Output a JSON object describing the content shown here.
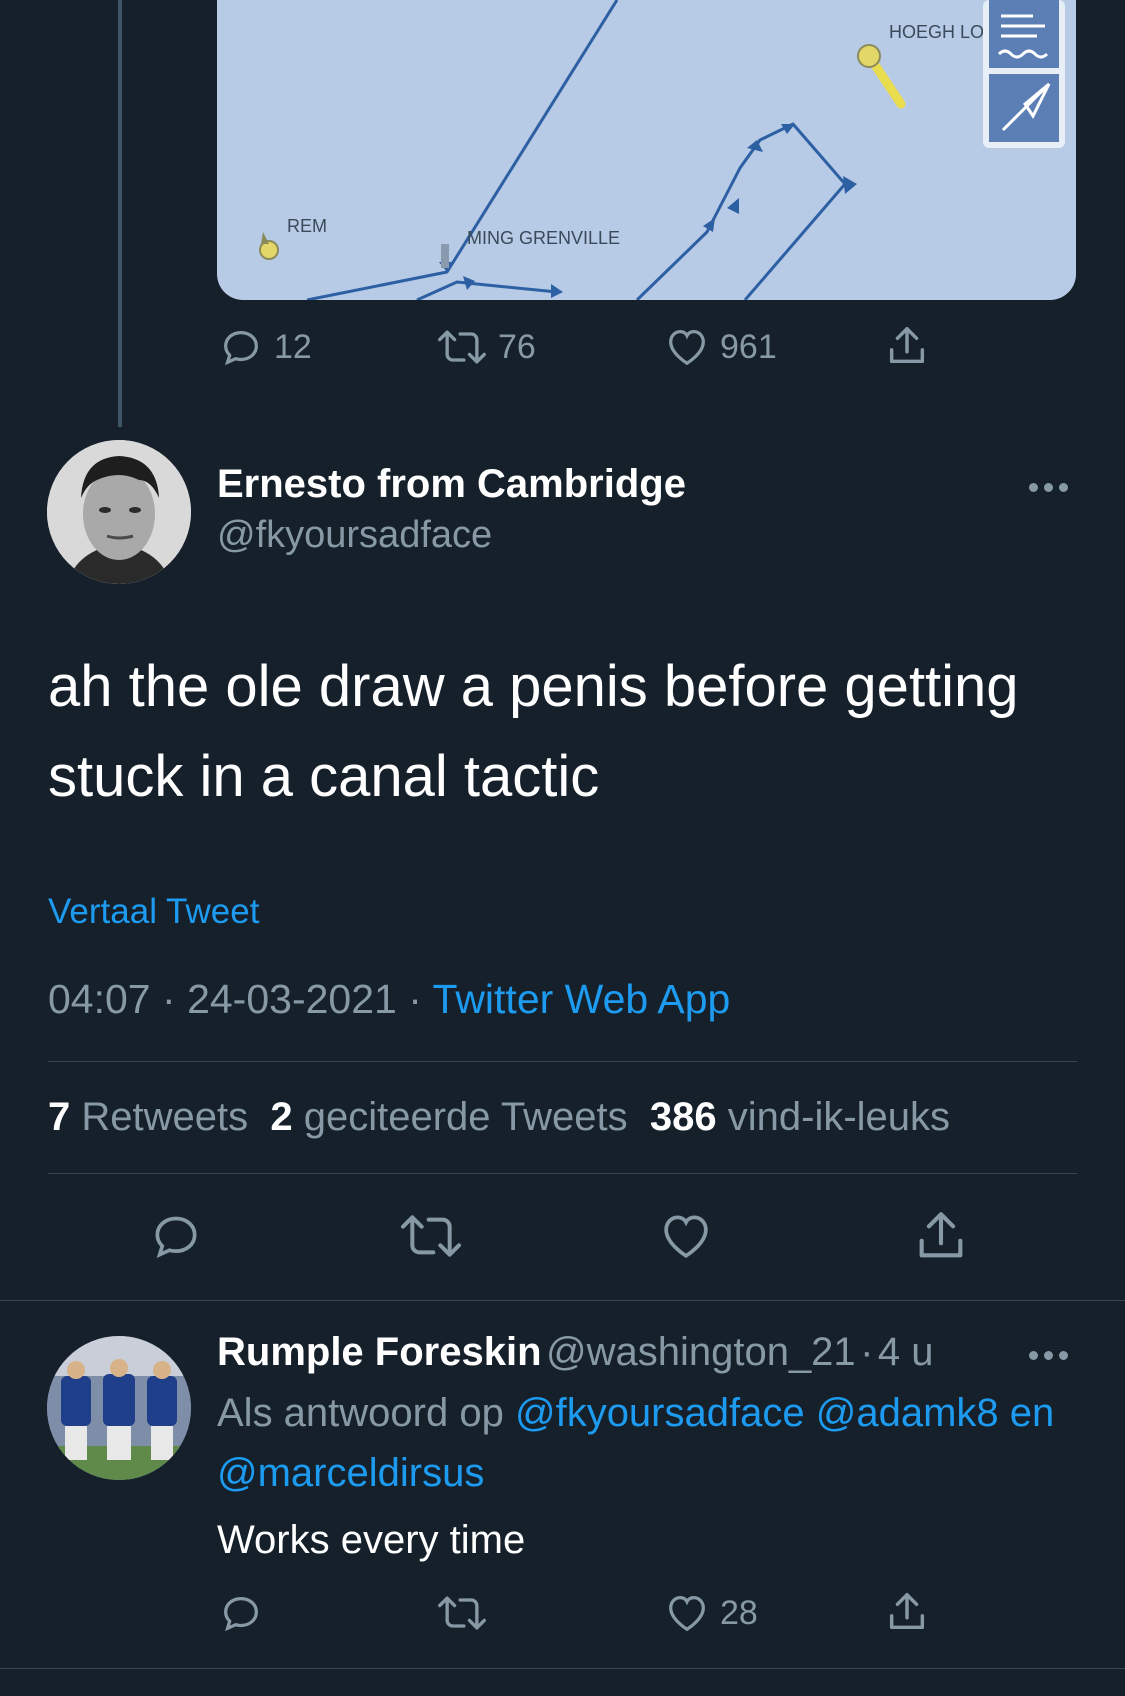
{
  "embedded_tweet": {
    "map_labels": [
      "HOEGH LO",
      "REM",
      "MING GRENVILLE"
    ],
    "actions": {
      "replies": "12",
      "retweets": "76",
      "likes": "961"
    }
  },
  "main_tweet": {
    "author_name": "Ernesto from Cambridge",
    "author_handle": "@fkyoursadface",
    "text_line1": "ah the ole draw a penis before getting",
    "text_line2": "stuck in a canal tactic",
    "translate_label": "Vertaal Tweet",
    "time": "04:07",
    "separator": "·",
    "date": "24-03-2021",
    "source": "Twitter Web App",
    "stats": {
      "retweets_count": "7",
      "retweets_label": "Retweets",
      "quotes_count": "2",
      "quotes_label": "geciteerde Tweets",
      "likes_count": "386",
      "likes_label": "vind-ik-leuks"
    }
  },
  "reply": {
    "author_name": "Rumple Foreskin",
    "author_handle": "@washington_21",
    "separator": "·",
    "time_ago": "4 u",
    "context_prefix": "Als antwoord op",
    "mention1": "@fkyoursadface",
    "mention2": "@adamk8",
    "context_and": "en",
    "mention3": "@marceldirsus",
    "text": "Works every time",
    "likes": "28"
  },
  "icons": {
    "reply": "reply-icon",
    "retweet": "retweet-icon",
    "like": "heart-icon",
    "share": "share-icon",
    "more": "more-icon"
  },
  "colors": {
    "background": "#15202b",
    "accent": "#1d9bf0",
    "secondary_text": "#8899a6",
    "map_water": "#b7cae6",
    "route": "#2d5fa3"
  }
}
